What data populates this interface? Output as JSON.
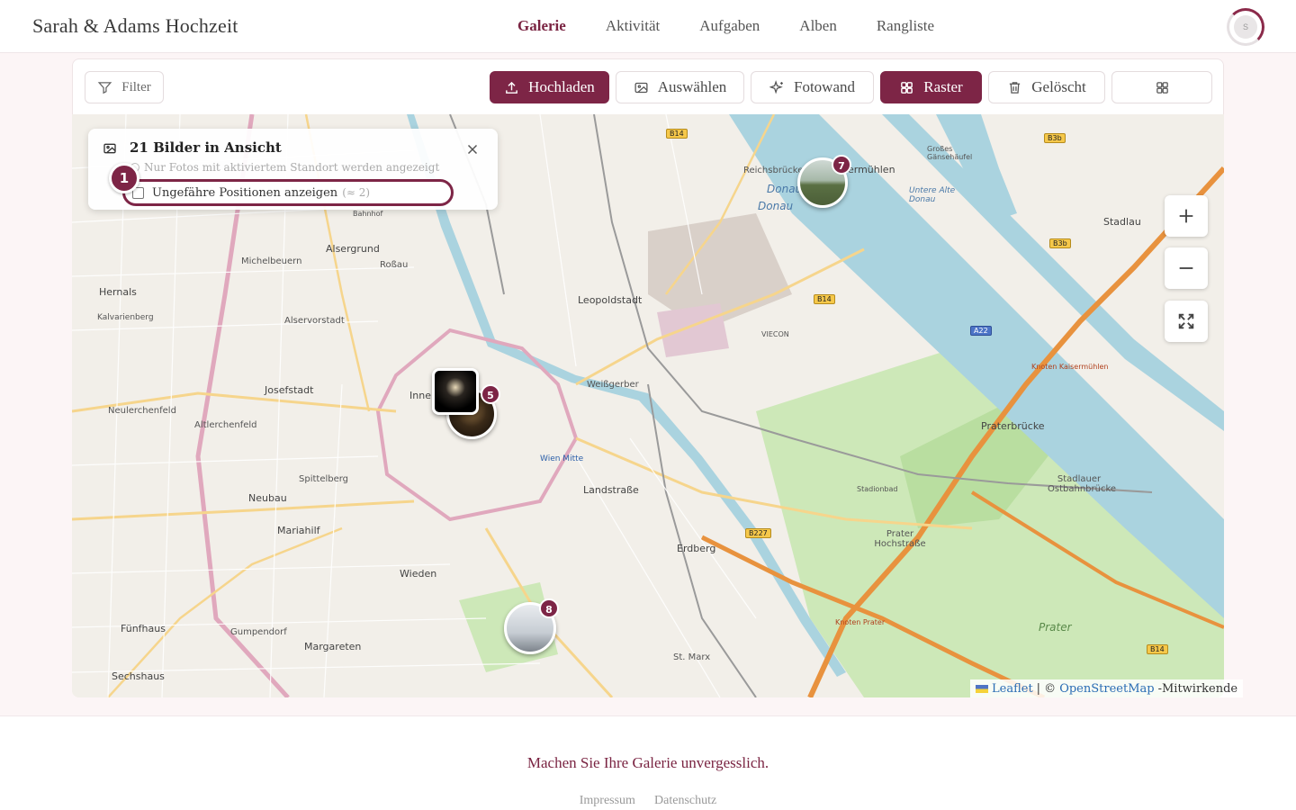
{
  "header": {
    "brand": "Sarah & Adams Hochzeit",
    "nav": [
      {
        "label": "Galerie",
        "active": true
      },
      {
        "label": "Aktivität"
      },
      {
        "label": "Aufgaben"
      },
      {
        "label": "Alben"
      },
      {
        "label": "Rangliste"
      }
    ],
    "avatar_initial": "S"
  },
  "toolbar": {
    "filter_label": "Filter",
    "upload_label": "Hochladen",
    "select_label": "Auswählen",
    "photowall_label": "Fotowand",
    "grid_label": "Raster",
    "deleted_label": "Gelöscht",
    "view_toggle_icon": "grid-icon"
  },
  "map_panel": {
    "title": "21 Bilder in Ansicht",
    "note": "Nur Fotos mit aktiviertem Standort werden angezeigt",
    "approx_label": "Ungefähre Positionen anzeigen",
    "approx_count": "(≈ 2)",
    "approx_checked": false,
    "step_number": "1"
  },
  "map_markers": [
    {
      "name": "cluster-north",
      "count": "7"
    },
    {
      "name": "cluster-center",
      "count": "5"
    },
    {
      "name": "cluster-south",
      "count": "8"
    }
  ],
  "map_labels": {
    "reichsbruecke": "Reichsbrücke",
    "donau": "Donau",
    "kaisermuehlen": "ermühlen",
    "grosses_gaensehaeufel": "Großes Gänsehäufel",
    "untere_alte_donau": "Untere Alte Donau",
    "stadlau": "Stadlau",
    "alsergrund": "Alsergrund",
    "rossau": "Roßau",
    "michelbeuern": "Michelbeuern",
    "hernals": "Hernals",
    "kalvarienberg": "Kalvarienberg",
    "alservorstadt": "Alservorstadt",
    "leopoldstadt": "Leopoldstadt",
    "josefstadt": "Josefstadt",
    "innere": "Inne",
    "weissgerber": "Weißgerber",
    "neulerchenfeld": "Neulerchenfeld",
    "altlerchenfeld": "Altlerchenfeld",
    "spittelberg": "Spittelberg",
    "neubau": "Neubau",
    "mariahilf": "Mariahilf",
    "landstrasse": "Landstraße",
    "wien_mitte": "Wien Mitte",
    "wieden": "Wieden",
    "erdberg": "Erdberg",
    "fuenfhaus": "Fünfhaus",
    "gumpendorf": "Gumpendorf",
    "margareten": "Margareten",
    "sechshaus": "Sechshaus",
    "praterbruecke": "Praterbrücke",
    "stadlauer": "Stadlauer Ostbahnbrücke",
    "prater_hochstrasse": "Prater Hochstraße",
    "prater": "Prater",
    "stadionbad": "Stadionbad",
    "st_marx": "St. Marx",
    "viecon": "VIECON",
    "bahnhof": "Bahnhof",
    "knoten_kaisermuehlen": "Knoten Kaisermühlen",
    "knoten_prater": "Knoten Prater"
  },
  "road_shields": {
    "b14_top": "B14",
    "b14_mid": "B14",
    "b3b_top": "B3b",
    "b3b_mid": "B3b",
    "a22": "A22",
    "b227": "B227",
    "b14_bottom": "B14"
  },
  "attribution": {
    "leaflet": "Leaflet",
    "sep": "| ©",
    "osm": "OpenStreetMap",
    "suffix": "-Mitwirkende"
  },
  "footer": {
    "tagline": "Machen Sie Ihre Galerie unvergesslich.",
    "impressum": "Impressum",
    "datenschutz": "Datenschutz"
  },
  "colors": {
    "accent": "#7d2546",
    "water": "#aad3df",
    "park": "#c8e6b0",
    "motorway": "#e8923e"
  }
}
